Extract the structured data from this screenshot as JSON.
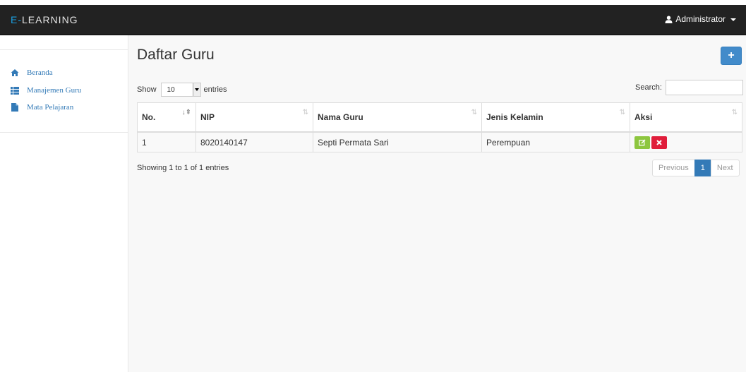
{
  "navbar": {
    "brand_prefix": "E-",
    "brand_main": "LEARNING",
    "user_label": "Administrator"
  },
  "sidebar": {
    "items": [
      {
        "label": "Beranda",
        "icon": "home-icon"
      },
      {
        "label": "Manajemen  Guru",
        "icon": "list-icon"
      },
      {
        "label": "Mata  Pelajaran",
        "icon": "file-icon"
      }
    ]
  },
  "main": {
    "title": "Daftar Guru",
    "add_label": "+",
    "show_label": "Show",
    "entries_value": "10",
    "entries_label": "entries",
    "search_label": "Search:",
    "search_value": "",
    "table": {
      "columns": [
        "No.",
        "NIP",
        "Nama Guru",
        "Jenis Kelamin",
        "Aksi"
      ],
      "rows": [
        {
          "no": "1",
          "nip": "8020140147",
          "nama": "Septi Permata Sari",
          "jenis_kelamin": "Perempuan"
        }
      ]
    },
    "info": "Showing 1 to 1 of 1 entries",
    "pagination": {
      "previous": "Previous",
      "page": "1",
      "next": "Next"
    }
  },
  "colors": {
    "navbar": "#222222",
    "brand_accent": "#1ba0e1",
    "primary": "#428bca",
    "edit": "#8dc63f",
    "delete": "#e01d3b"
  }
}
